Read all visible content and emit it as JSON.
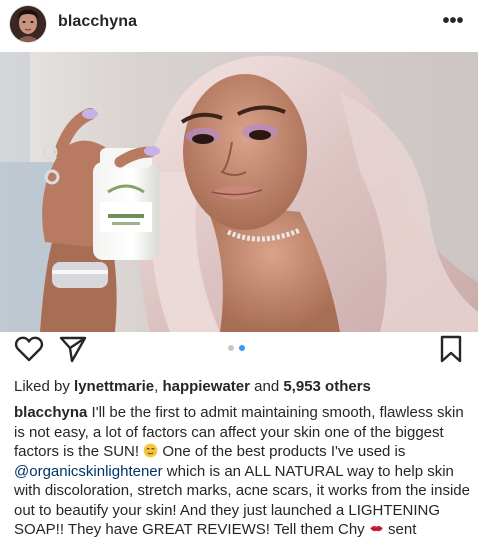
{
  "post": {
    "username": "blacchyna",
    "more_icon": "more-horizontal-icon",
    "more_label": "•••",
    "avatar_icon": "profile-avatar"
  },
  "actions": {
    "like_icon": "heart-icon",
    "share_icon": "send-paper-plane-icon",
    "save_icon": "bookmark-icon",
    "carousel": {
      "count": 2,
      "active_index": 1
    }
  },
  "likes": {
    "prefix": "Liked by ",
    "user1": "lynettmarie",
    "sep": ", ",
    "user2": "happiewater",
    "and": " and ",
    "count": "5,953 others"
  },
  "caption": {
    "user": "blacchyna",
    "text1": " I'll be the first to admit maintaining smooth, flawless skin is not easy, a lot of factors can affect your skin one of the biggest factors is the SUN! ",
    "emoji1": "relieved-face-emoji",
    "text2": " One of the best products I've used is ",
    "mention": "@organicskinlightener",
    "text3": " which is an ALL NATURAL way to help skin with discoloration, stretch marks, acne scars, it works from the inside out to beautify your skin! And they just launched a LIGHTENING SOAP!! They have GREAT REVIEWS! Tell them Chy ",
    "emoji2": "kiss-mark-emoji",
    "text4": " sent"
  },
  "colors": {
    "text": "#262626",
    "mention": "#003569",
    "dot_active": "#3897f0",
    "dot_inactive": "#c7c7c7"
  }
}
